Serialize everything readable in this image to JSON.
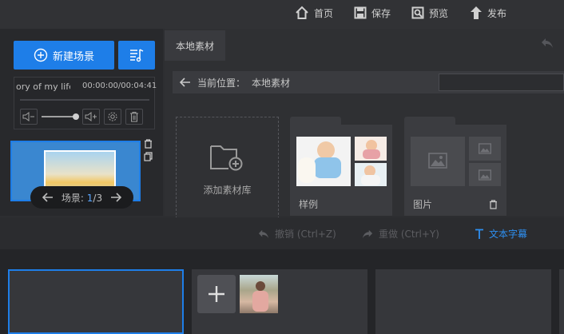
{
  "topbar": {
    "home_label": "首页",
    "save_label": "保存",
    "preview_label": "预览",
    "publish_label": "发布"
  },
  "left": {
    "new_scene_label": "新建场景",
    "music": {
      "title": "ory of my life",
      "time": "00:00:00/00:04:41"
    },
    "scene_counter": {
      "prefix": "场景:",
      "current": "1",
      "total": "/3"
    }
  },
  "material": {
    "tab_label": "本地素材",
    "path_label": "当前位置：",
    "path_value": "本地素材",
    "add_library_label": "添加素材库",
    "folders": [
      {
        "label": "样例"
      },
      {
        "label": "图片"
      }
    ]
  },
  "toolbar": {
    "undo_label": "撤销 (Ctrl+Z)",
    "redo_label": "重做 (Ctrl+Y)",
    "text_label": "文本字幕"
  },
  "colors": {
    "accent": "#1e7ee8",
    "disabled": "#5c5d61"
  }
}
